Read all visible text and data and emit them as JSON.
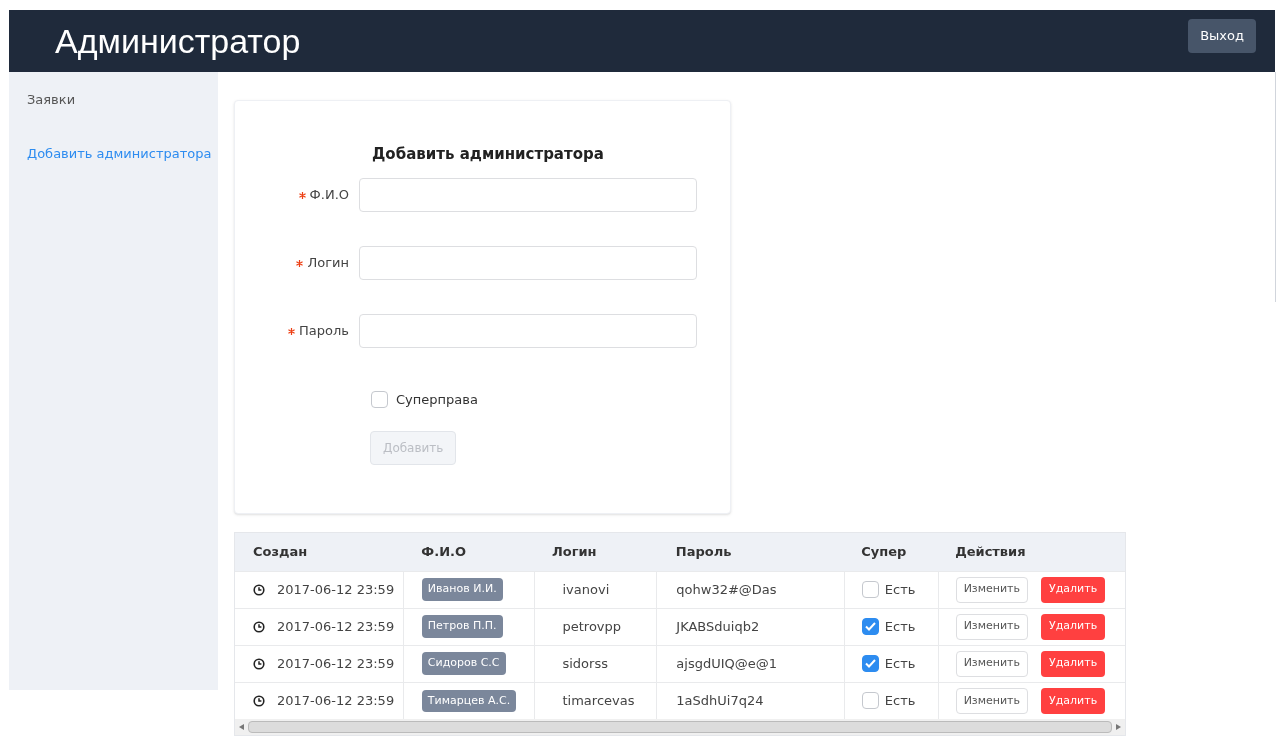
{
  "header": {
    "title": "Администратор",
    "logout": "Выход"
  },
  "sidebar": {
    "items": [
      {
        "label": "Заявки",
        "selected": false
      },
      {
        "label": "Добавить администратора",
        "selected": true
      }
    ]
  },
  "form": {
    "title": "Добавить администратора",
    "fields": [
      {
        "label": "Ф.И.О",
        "required": true
      },
      {
        "label": "Логин",
        "required": true
      },
      {
        "label": "Пароль",
        "required": true
      }
    ],
    "checkbox": {
      "label": "Суперправа",
      "checked": false
    },
    "submit": {
      "label": "Добавить",
      "disabled": true
    }
  },
  "table": {
    "columns": [
      "Создан",
      "Ф.И.О",
      "Логин",
      "Пароль",
      "Супер",
      "Действия"
    ],
    "rows": [
      {
        "created": "2017-06-12 23:59",
        "name": "Иванов И.И.",
        "login": "ivanovi",
        "password": "qohw32#@Das",
        "super": {
          "checked": false,
          "label": "Есть"
        },
        "actions": [
          "Изменить",
          "Удалить"
        ]
      },
      {
        "created": "2017-06-12 23:59",
        "name": "Петров П.П.",
        "login": "petrovpp",
        "password": "JKABSduiqb2",
        "super": {
          "checked": true,
          "label": "Есть"
        },
        "actions": [
          "Изменить",
          "Удалить"
        ]
      },
      {
        "created": "2017-06-12 23:59",
        "name": "Сидоров С.С",
        "login": "sidorss",
        "password": "ajsgdUIQ@e@1",
        "super": {
          "checked": true,
          "label": "Есть"
        },
        "actions": [
          "Изменить",
          "Удалить"
        ]
      },
      {
        "created": "2017-06-12 23:59",
        "name": "Тимарцев А.С.",
        "login": "timarcevas",
        "password": "1aSdhUi7q24",
        "super": {
          "checked": false,
          "label": "Есть"
        },
        "actions": [
          "Изменить",
          "Удалить"
        ]
      }
    ]
  }
}
